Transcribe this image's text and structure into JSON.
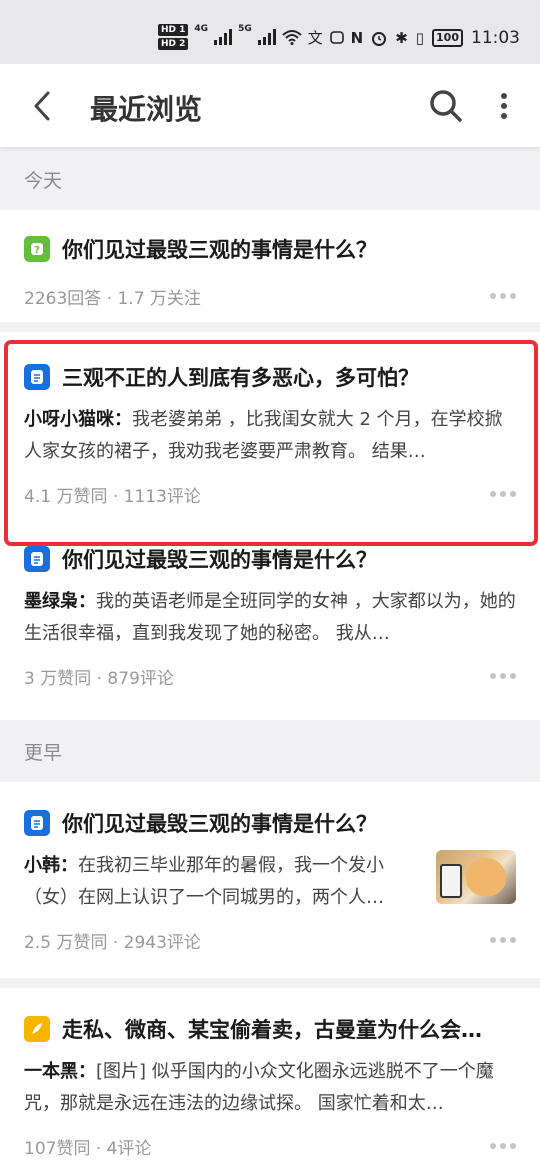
{
  "status_bar": {
    "hd1": "HD 1",
    "hd2": "HD 2",
    "net1": "4G",
    "net2": "5G",
    "battery": "100",
    "time": "11:03"
  },
  "header": {
    "title": "最近浏览"
  },
  "sections": {
    "today": "今天",
    "earlier": "更早"
  },
  "items": [
    {
      "type": "question",
      "title": "你们见过最毁三观的事情是什么？",
      "meta": "2263回答 · 1.7 万关注"
    },
    {
      "type": "answer",
      "title": "三观不正的人到底有多恶心，多可怕？",
      "author": "小呀小猫咪：",
      "excerpt": "我老婆弟弟 ，比我闺女就大 2 个月，在学校掀人家女孩的裙子，我劝我老婆要严肃教育。 结果…",
      "meta": "4.1 万赞同 · 1113评论"
    },
    {
      "type": "answer",
      "title": "你们见过最毁三观的事情是什么？",
      "author": "墨绿枭：",
      "excerpt": "我的英语老师是全班同学的女神 ，大家都以为，她的生活很幸福，直到我发现了她的秘密。 我从…",
      "meta": "3 万赞同 · 879评论"
    },
    {
      "type": "answer",
      "title": "你们见过最毁三观的事情是什么？",
      "author": "小韩：",
      "excerpt": "在我初三毕业那年的暑假，我一个发小（女）在网上认识了一个同城男的，两个人…",
      "meta": "2.5 万赞同 · 2943评论"
    },
    {
      "type": "article",
      "title": "走私、微商、某宝偷着卖，古曼童为什么会…",
      "author": "一本黑：",
      "excerpt": "[图片] 似乎国内的小众文化圈永远逃脱不了一个魔咒，那就是永远在违法的边缘试探。 国家忙着和太…",
      "meta": "107赞同 · 4评论"
    }
  ]
}
